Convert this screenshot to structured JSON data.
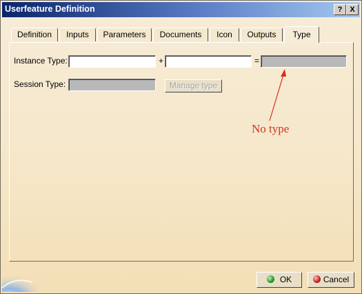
{
  "window": {
    "title": "Userfeature Definition"
  },
  "titlebar_buttons": {
    "help": "?",
    "close": "X"
  },
  "tabs": [
    {
      "label": "Definition",
      "active": false
    },
    {
      "label": "Inputs",
      "active": false
    },
    {
      "label": "Parameters",
      "active": false
    },
    {
      "label": "Documents",
      "active": false
    },
    {
      "label": "Icon",
      "active": false
    },
    {
      "label": "Outputs",
      "active": false
    },
    {
      "label": "Type",
      "active": true
    }
  ],
  "type_tab": {
    "instance_type_label": "Instance Type:",
    "instance_type_value_1": "",
    "plus_sign": "+",
    "instance_type_value_2": "",
    "equals_sign": "=",
    "resulting_type_value": "",
    "session_type_label": "Session Type:",
    "session_type_value": "",
    "manage_type_button": "Manage type"
  },
  "annotation": {
    "text": "No type",
    "color": "#d2321e"
  },
  "footer": {
    "ok_label": "OK",
    "cancel_label": "Cancel",
    "ok_icon_color": "#1f9a1f",
    "cancel_icon_color": "#c21d1d"
  }
}
